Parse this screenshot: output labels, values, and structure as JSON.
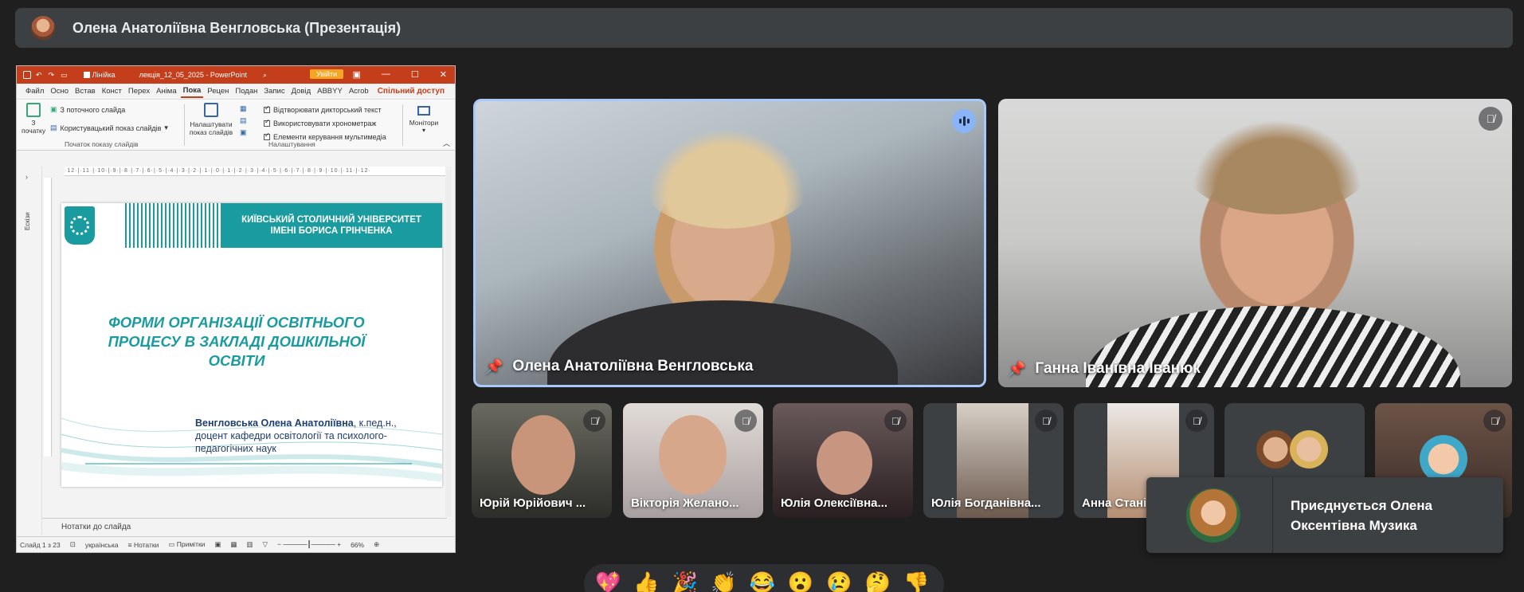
{
  "presenter_bar": {
    "title": "Олена Анатоліївна Венгловська (Презентація)"
  },
  "powerpoint": {
    "titlebar": {
      "ruler_label": "Лінійка",
      "filename": "лекція_12_05_2025 - PowerPoint",
      "sign_in": "Увійти"
    },
    "tabs": [
      "Файл",
      "Осно",
      "Встав",
      "Конст",
      "Перех",
      "Аніма",
      "Пока",
      "Рецен",
      "Подан",
      "Запис",
      "Довід",
      "ABBYY",
      "Acrob"
    ],
    "active_tab": "Пока",
    "share_label": "Спільний доступ",
    "ribbon": {
      "from_start": "З початку",
      "from_current": "З поточного слайда",
      "custom_show": "Користувацький показ слайдів",
      "group1_label": "Початок показу слайдів",
      "setup_show": "Налаштувати показ слайдів",
      "opt1": "Відтворювати дикторський текст",
      "opt2": "Використовувати хронометраж",
      "opt3": "Елементи керування мультимедіа",
      "group2_label": "Налаштування",
      "monitors": "Монітори"
    },
    "ruler_text": "·12·|·11·|·10·|·9·|·8·|·7·|·6·|·5·|·4·|·3·|·2·|·1·|·0·|·1·|·2·|·3·|·4·|·5·|·6·|·7·|·8·|·9·|·10·|·11·|·12·",
    "side_panel_label": "Ескізи",
    "slide": {
      "university_line1": "КИЇВСЬКИЙ СТОЛИЧНИЙ УНІВЕРСИТЕТ",
      "university_line2": "ІМЕНІ БОРИСА ГРІНЧЕНКА",
      "title_line1": "ФОРМИ ОРГАНІЗАЦІЇ ОСВІТНЬОГО",
      "title_line2": "ПРОЦЕСУ В ЗАКЛАДІ ДОШКІЛЬНОЇ",
      "title_line3": "ОСВІТИ",
      "author_name": "Венгловська Олена Анатоліївна",
      "author_rest": ", к.пед.н.,",
      "author_line2": "доцент кафедри освітології та психолого-",
      "author_line3": "педагогічних наук"
    },
    "notes_label": "Нотатки до слайда",
    "status": {
      "slide_num": "Слайд 1 з 23",
      "language": "українська",
      "notes": "Нотатки",
      "comments": "Примітки",
      "zoom": "66%"
    }
  },
  "participants": {
    "main": [
      {
        "name": "Олена Анатоліївна Венгловська",
        "speaking": true
      },
      {
        "name": "Ганна Іванівна Іванюк",
        "muted": true
      }
    ],
    "small": [
      {
        "name": "Юрій Юрійович ...",
        "muted": true
      },
      {
        "name": "Вікторія Желано...",
        "muted": true
      },
      {
        "name": "Юлія Олексіївна...",
        "muted": true
      },
      {
        "name": "Юлія Богданівна...",
        "muted": true
      },
      {
        "name": "Анна Стані",
        "muted": true
      },
      {
        "name": "",
        "muted": false
      },
      {
        "name": "",
        "muted": true
      }
    ]
  },
  "toast": {
    "line1": "Приєднується Олена",
    "line2": "Оксентівна Музика"
  },
  "reactions": [
    "💖",
    "👍",
    "🎉",
    "👏",
    "😂",
    "😮",
    "😢",
    "🤔",
    "👎"
  ]
}
